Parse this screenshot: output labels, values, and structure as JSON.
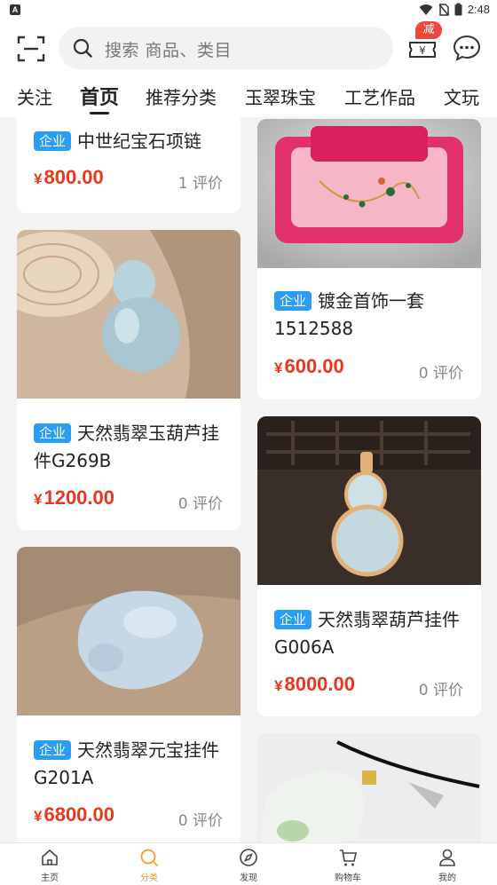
{
  "status_bar": {
    "app_badge": "A",
    "time": "2:48"
  },
  "header": {
    "search_placeholder": "搜索 商品、类目",
    "coupon_badge": "减"
  },
  "tabs": [
    {
      "label": "关注"
    },
    {
      "label": "首页",
      "active": true
    },
    {
      "label": "推荐分类"
    },
    {
      "label": "玉翠珠宝"
    },
    {
      "label": "工艺作品"
    },
    {
      "label": "文玩"
    }
  ],
  "products": [
    {
      "tag": "企业",
      "title": "中世纪宝石项链",
      "price": "800.00",
      "currency": "¥",
      "reviews": "1 评价"
    },
    {
      "tag": "企业",
      "title": "镀金首饰一套1512588",
      "price": "600.00",
      "currency": "¥",
      "reviews": "0 评价"
    },
    {
      "tag": "企业",
      "title": "天然翡翠玉葫芦挂件G269B",
      "price": "1200.00",
      "currency": "¥",
      "reviews": "0 评价"
    },
    {
      "tag": "企业",
      "title": "天然翡翠葫芦挂件G006A",
      "price": "8000.00",
      "currency": "¥",
      "reviews": "0 评价"
    },
    {
      "tag": "企业",
      "title": "天然翡翠元宝挂件G201A",
      "price": "6800.00",
      "currency": "¥",
      "reviews": "0 评价"
    }
  ],
  "bottom_nav": [
    {
      "label": "主页",
      "icon": "home-icon"
    },
    {
      "label": "分类",
      "icon": "search-icon",
      "active": true
    },
    {
      "label": "发现",
      "icon": "compass-icon"
    },
    {
      "label": "购物车",
      "icon": "cart-icon"
    },
    {
      "label": "我的",
      "icon": "user-icon"
    }
  ],
  "colors": {
    "accent": "#f39c2b",
    "price": "#e8371c",
    "tag": "#2a9df4",
    "badge": "#f0443e"
  }
}
